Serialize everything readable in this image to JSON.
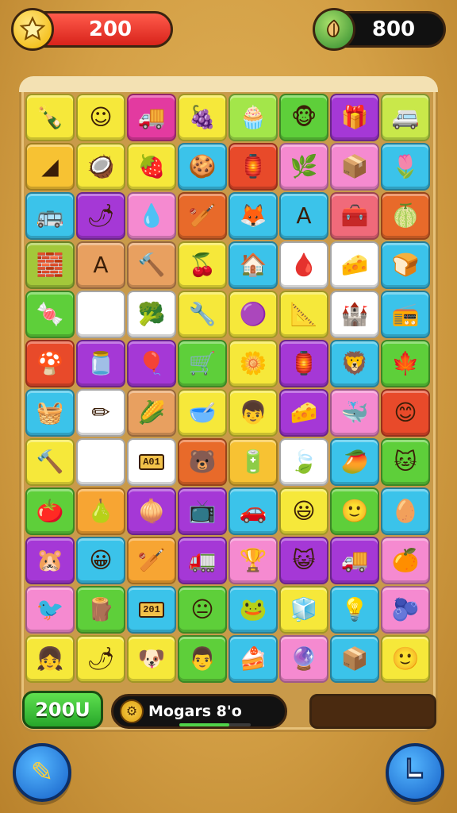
{
  "hud": {
    "coins": "200",
    "gems": "800",
    "coin_icon": "star-icon",
    "gem_icon": "leaf-icon"
  },
  "bottom": {
    "score": "200U",
    "player_name": "Mogars 8'o",
    "progress": 0.7
  },
  "buttons": {
    "left_icon": "pencil-icon",
    "right_icon": "boot-icon"
  },
  "tiles": [
    {
      "bg": "#f6e83a",
      "icon": "bottle-icon",
      "glyph": "🍾"
    },
    {
      "bg": "#f6e83a",
      "icon": "face-icon",
      "glyph": "☺"
    },
    {
      "bg": "#e33aa0",
      "icon": "truck-icon",
      "glyph": "🚚"
    },
    {
      "bg": "#f6e83a",
      "icon": "berries-icon",
      "glyph": "🍇"
    },
    {
      "bg": "#a3e64a",
      "icon": "cupcake-icon",
      "glyph": "🧁"
    },
    {
      "bg": "#5ecf3a",
      "icon": "monkey-icon",
      "glyph": "🐵"
    },
    {
      "bg": "#a538d6",
      "icon": "gift-icon",
      "glyph": "🎁"
    },
    {
      "bg": "#c9e84a",
      "icon": "van-icon",
      "glyph": "🚐"
    },
    {
      "bg": "#f7c233",
      "icon": "wedge-icon",
      "glyph": "◢"
    },
    {
      "bg": "#f6e83a",
      "icon": "coconut-icon",
      "glyph": "🥥"
    },
    {
      "bg": "#f6e83a",
      "icon": "strawberry-icon",
      "glyph": "🍓"
    },
    {
      "bg": "#3bc3ea",
      "icon": "cookie-icon",
      "glyph": "🍪"
    },
    {
      "bg": "#e84a2a",
      "icon": "lantern-icon",
      "glyph": "🏮"
    },
    {
      "bg": "#f58ad0",
      "icon": "bush-icon",
      "glyph": "🌿"
    },
    {
      "bg": "#f58ad0",
      "icon": "box-icon",
      "glyph": "📦"
    },
    {
      "bg": "#3bc3ea",
      "icon": "tulip-icon",
      "glyph": "🌷"
    },
    {
      "bg": "#3bc3ea",
      "icon": "bus-icon",
      "glyph": "🚌"
    },
    {
      "bg": "#a538d6",
      "icon": "chili-icon",
      "glyph": "🌶"
    },
    {
      "bg": "#f58ad0",
      "icon": "drop-icon",
      "glyph": "💧"
    },
    {
      "bg": "#e86a2a",
      "icon": "bat-icon",
      "glyph": "🏏"
    },
    {
      "bg": "#3bc3ea",
      "icon": "fox-icon",
      "glyph": "🦊"
    },
    {
      "bg": "#3bc3ea",
      "icon": "letter-a-icon",
      "glyph": "A"
    },
    {
      "bg": "#f06a7a",
      "icon": "chest-icon",
      "glyph": "🧰"
    },
    {
      "bg": "#e86a2a",
      "icon": "melon-icon",
      "glyph": "🍈"
    },
    {
      "bg": "#a3c83a",
      "icon": "crate-icon",
      "glyph": "🧱"
    },
    {
      "bg": "#e8a060",
      "icon": "letter-a-icon",
      "glyph": "A"
    },
    {
      "bg": "#e8a060",
      "icon": "hammer-icon",
      "glyph": "🔨"
    },
    {
      "bg": "#f6e83a",
      "icon": "cherries-icon",
      "glyph": "🍒"
    },
    {
      "bg": "#3bc3ea",
      "icon": "house-icon",
      "glyph": "🏠"
    },
    {
      "bg": "#ffffff",
      "icon": "drop-icon",
      "glyph": "🩸"
    },
    {
      "bg": "#ffffff",
      "icon": "cheese-icon",
      "glyph": "🧀"
    },
    {
      "bg": "#3bc3ea",
      "icon": "bread-icon",
      "glyph": "🍞"
    },
    {
      "bg": "#5ecf3a",
      "icon": "candy-icon",
      "glyph": "🍬",
      "blank_after": true
    },
    {
      "bg": "#ffffff",
      "icon": "broccoli-icon",
      "glyph": "🥦"
    },
    {
      "bg": "#f6e83a",
      "icon": "wrench-icon",
      "glyph": "🔧"
    },
    {
      "bg": "#f6e83a",
      "icon": "ball-icon",
      "glyph": "🟣"
    },
    {
      "bg": "#f6e83a",
      "icon": "wedge-icon",
      "glyph": "📐"
    },
    {
      "bg": "#ffffff",
      "icon": "castle-icon",
      "glyph": "🏰"
    },
    {
      "bg": "#3bc3ea",
      "icon": "radio-icon",
      "glyph": "📻"
    },
    {
      "bg": "#e84a2a",
      "icon": "blob-icon",
      "glyph": "🍄"
    },
    {
      "bg": "#a538d6",
      "icon": "jar-icon",
      "glyph": "🫙"
    },
    {
      "bg": "#a538d6",
      "icon": "balloon-icon",
      "glyph": "🎈"
    },
    {
      "bg": "#5ecf3a",
      "icon": "cart-icon",
      "glyph": "🛒"
    },
    {
      "bg": "#f6e83a",
      "icon": "flower-icon",
      "glyph": "🌼"
    },
    {
      "bg": "#a538d6",
      "icon": "lantern-icon",
      "glyph": "🏮"
    },
    {
      "bg": "#3bc3ea",
      "icon": "lion-icon",
      "glyph": "🦁"
    },
    {
      "bg": "#5ecf3a",
      "icon": "leaf-icon",
      "glyph": "🍁"
    },
    {
      "bg": "#3bc3ea",
      "icon": "basket-icon",
      "glyph": "🧺"
    },
    {
      "bg": "#ffffff",
      "icon": "pencil-icon",
      "glyph": "✏"
    },
    {
      "bg": "#e8a060",
      "icon": "corn-icon",
      "glyph": "🌽"
    },
    {
      "bg": "#f6e83a",
      "icon": "bowl-icon",
      "glyph": "🥣"
    },
    {
      "bg": "#f6e83a",
      "icon": "boy-icon",
      "glyph": "👦"
    },
    {
      "bg": "#a538d6",
      "icon": "nacho-icon",
      "glyph": "🧀"
    },
    {
      "bg": "#f58ad0",
      "icon": "whale-icon",
      "glyph": "🐳"
    },
    {
      "bg": "#e84a2a",
      "icon": "smiley-icon",
      "glyph": "😊"
    },
    {
      "bg": "#f6e83a",
      "icon": "hammer-icon",
      "glyph": "🔨",
      "blank_after": true
    },
    {
      "bg": "#ffffff",
      "icon": "sign-icon",
      "glyph": "",
      "label": "A01"
    },
    {
      "bg": "#e86a2a",
      "icon": "bear-icon",
      "glyph": "🐻"
    },
    {
      "bg": "#f7c233",
      "icon": "battery-icon",
      "glyph": "🔋"
    },
    {
      "bg": "#ffffff",
      "icon": "leaf-icon",
      "glyph": "🍃"
    },
    {
      "bg": "#3bc3ea",
      "icon": "mango-icon",
      "glyph": "🥭"
    },
    {
      "bg": "#5ecf3a",
      "icon": "cat-icon",
      "glyph": "🐱"
    },
    {
      "bg": "#5ecf3a",
      "icon": "tomato-icon",
      "glyph": "🍅"
    },
    {
      "bg": "#f7a533",
      "icon": "pear-icon",
      "glyph": "🍐"
    },
    {
      "bg": "#a538d6",
      "icon": "onion-icon",
      "glyph": "🧅"
    },
    {
      "bg": "#a538d6",
      "icon": "oven-icon",
      "glyph": "📺"
    },
    {
      "bg": "#3bc3ea",
      "icon": "car-icon",
      "glyph": "🚗"
    },
    {
      "bg": "#f6e83a",
      "icon": "smiley-icon",
      "glyph": "😃"
    },
    {
      "bg": "#5ecf3a",
      "icon": "smiley-icon",
      "glyph": "🙂"
    },
    {
      "bg": "#3bc3ea",
      "icon": "seed-icon",
      "glyph": "🥚"
    },
    {
      "bg": "#a538d6",
      "icon": "bear-icon",
      "glyph": "🐹"
    },
    {
      "bg": "#3bc3ea",
      "icon": "smiley-icon",
      "glyph": "😀"
    },
    {
      "bg": "#f7a533",
      "icon": "bat-icon",
      "glyph": "🏏"
    },
    {
      "bg": "#a538d6",
      "icon": "truck-icon",
      "glyph": "🚛"
    },
    {
      "bg": "#f58ad0",
      "icon": "trophy-icon",
      "glyph": "🏆"
    },
    {
      "bg": "#a538d6",
      "icon": "cat-icon",
      "glyph": "😺"
    },
    {
      "bg": "#a538d6",
      "icon": "truck-icon",
      "glyph": "🚚"
    },
    {
      "bg": "#f58ad0",
      "icon": "blob-icon",
      "glyph": "🍊"
    },
    {
      "bg": "#f58ad0",
      "icon": "bird-icon",
      "glyph": "🐦"
    },
    {
      "bg": "#5ecf3a",
      "icon": "wood-icon",
      "glyph": "🪵"
    },
    {
      "bg": "#3bc3ea",
      "icon": "sign-icon",
      "glyph": "",
      "label": "201"
    },
    {
      "bg": "#5ecf3a",
      "icon": "smiley-icon",
      "glyph": "😐"
    },
    {
      "bg": "#3bc3ea",
      "icon": "frog-icon",
      "glyph": "🐸"
    },
    {
      "bg": "#f6e83a",
      "icon": "cube-icon",
      "glyph": "🧊"
    },
    {
      "bg": "#3bc3ea",
      "icon": "lamp-icon",
      "glyph": "💡"
    },
    {
      "bg": "#f58ad0",
      "icon": "blob-icon",
      "glyph": "🫐"
    },
    {
      "bg": "#f6e83a",
      "icon": "girl-icon",
      "glyph": "👧"
    },
    {
      "bg": "#f6e83a",
      "icon": "chili-icon",
      "glyph": "🌶"
    },
    {
      "bg": "#f6e83a",
      "icon": "dog-icon",
      "glyph": "🐶"
    },
    {
      "bg": "#5ecf3a",
      "icon": "boy-icon",
      "glyph": "👨"
    },
    {
      "bg": "#3bc3ea",
      "icon": "cake-icon",
      "glyph": "🍰"
    },
    {
      "bg": "#f58ad0",
      "icon": "ball-icon",
      "glyph": "🔮"
    },
    {
      "bg": "#3bc3ea",
      "icon": "crate-icon",
      "glyph": "📦"
    },
    {
      "bg": "#f6e83a",
      "icon": "smiley-icon",
      "glyph": "🙂"
    }
  ]
}
